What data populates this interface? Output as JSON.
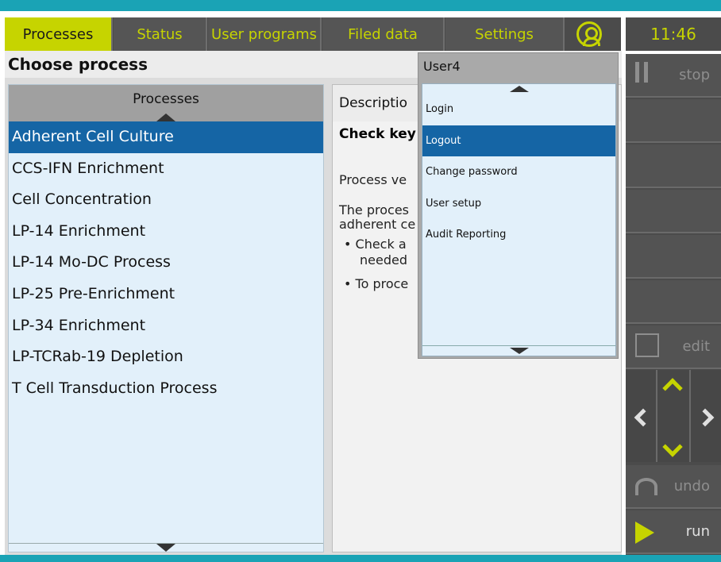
{
  "tabs": [
    {
      "label": "Processes"
    },
    {
      "label": "Status"
    },
    {
      "label": "User programs"
    },
    {
      "label": "Filed data"
    },
    {
      "label": "Settings"
    }
  ],
  "clock": "11:46",
  "main": {
    "heading": "Choose process",
    "processes_header": "Processes",
    "processes": [
      "Adherent Cell Culture",
      "CCS-IFN Enrichment",
      "Cell Concentration",
      "LP-14 Enrichment",
      "LP-14 Mo-DC Process",
      "LP-25 Pre-Enrichment",
      "LP-34 Enrichment",
      "LP-TCRab-19 Depletion",
      "T Cell Transduction Process"
    ],
    "description_header": "Descriptio",
    "description_title": "Check key",
    "description_version": "Process ve",
    "description_text_1": "The proces",
    "description_text_2": "adherent ce",
    "bullet_1a": "• Check a",
    "bullet_1b": "needed",
    "bullet_2": "• To proce"
  },
  "user_menu": {
    "user": "User4",
    "items": [
      "Login",
      "Logout",
      "Change password",
      "User setup",
      "Audit Reporting"
    ],
    "selected": "Logout"
  },
  "sidebar": {
    "stop": "stop",
    "edit": "edit",
    "undo": "undo",
    "run": "run"
  },
  "colors": {
    "accent": "#c6d400",
    "selection": "#1565a5",
    "frame": "#1aa3b5"
  }
}
